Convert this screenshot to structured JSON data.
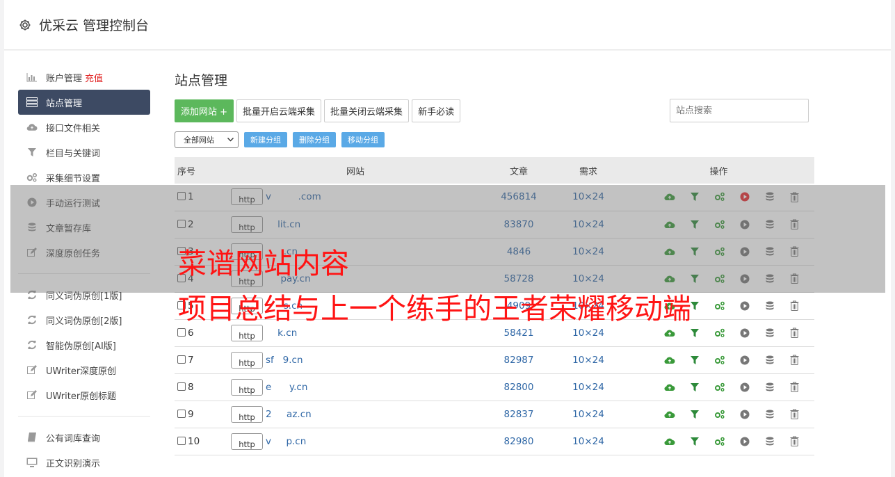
{
  "header": {
    "icon": "gear-icon",
    "title": "优采云 管理控制台"
  },
  "sidebar": {
    "items": [
      {
        "label": "账户管理",
        "badge": "充值",
        "icon": "bar-chart-icon"
      },
      {
        "label": "站点管理",
        "icon": "server-icon",
        "active": true
      },
      {
        "label": "接口文件相关",
        "icon": "cloud-upload-icon"
      },
      {
        "label": "栏目与关键词",
        "icon": "filter-icon"
      },
      {
        "label": "采集细节设置",
        "icon": "gears-icon"
      },
      {
        "label": "手动运行测试",
        "icon": "play-icon"
      },
      {
        "label": "文章暂存库",
        "icon": "database-icon"
      },
      {
        "label": "深度原创任务",
        "icon": "edit-icon"
      },
      {
        "label": "同义词伪原创[1版]",
        "icon": "refresh-icon"
      },
      {
        "label": "同义词伪原创[2版]",
        "icon": "refresh-icon"
      },
      {
        "label": "智能伪原创[AI版]",
        "icon": "refresh-icon"
      },
      {
        "label": "UWriter深度原创",
        "icon": "edit-icon"
      },
      {
        "label": "UWriter原创标题",
        "icon": "edit-icon"
      },
      {
        "label": "公有词库查询",
        "icon": "book-icon"
      },
      {
        "label": "正文识别演示",
        "icon": "monitor-icon"
      }
    ]
  },
  "main": {
    "title": "站点管理",
    "toolbar": {
      "add_site": "添加网站 +",
      "batch_on": "批量开启云端采集",
      "batch_off": "批量关闭云端采集",
      "guide": "新手必读",
      "search_placeholder": "站点搜索"
    },
    "group": {
      "select_value": "全部网站",
      "new_group": "新建分组",
      "delete_group": "删除分组",
      "move_group": "移动分组"
    },
    "table": {
      "headers": {
        "no": "序号",
        "site": "网站",
        "articles": "文章",
        "need": "需求",
        "ops": "操作"
      },
      "protocol": "http",
      "rows": [
        {
          "no": "1",
          "domain": "v         .com",
          "articles": "456814",
          "need": "10×24",
          "run_active": true
        },
        {
          "no": "2",
          "domain": "    lit.cn",
          "articles": "83870",
          "need": "10×24"
        },
        {
          "no": "3",
          "domain": "      .cn",
          "articles": "4846",
          "need": "10×24"
        },
        {
          "no": "4",
          "domain": "     pay.cn",
          "articles": "58728",
          "need": "10×24"
        },
        {
          "no": "5",
          "domain": "      s.cn",
          "articles": "4909",
          "need": "10×24"
        },
        {
          "no": "6",
          "domain": "    k.cn",
          "articles": "58421",
          "need": "10×24"
        },
        {
          "no": "7",
          "domain": "sf   9.cn",
          "articles": "82987",
          "need": "10×24"
        },
        {
          "no": "8",
          "domain": "e      y.cn",
          "articles": "82800",
          "need": "10×24"
        },
        {
          "no": "9",
          "domain": "2     az.cn",
          "articles": "82837",
          "need": "10×24"
        },
        {
          "no": "10",
          "domain": "v     p.cn",
          "articles": "82980",
          "need": "10×24"
        }
      ]
    }
  },
  "watermark": {
    "line1": "菜谱网站内容",
    "line2": "项目总结与上一个练手的王者荣耀移动端"
  },
  "colors": {
    "primary_nav": "#3d4a63",
    "green": "#5cb85c",
    "blue": "#5aa9e6",
    "link": "#2f67a6",
    "red": "#e02020"
  }
}
